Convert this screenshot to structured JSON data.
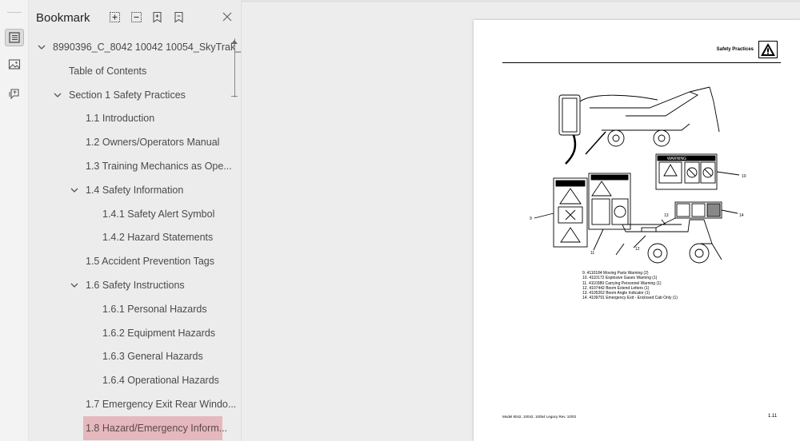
{
  "panel": {
    "title": "Bookmark"
  },
  "tree": [
    {
      "label": "8990396_C_8042 10042 10054_SkyTrak_...",
      "level": 0,
      "expanded": true
    },
    {
      "label": "Table of Contents",
      "level": 1,
      "expanded": null
    },
    {
      "label": "Section 1 Safety Practices",
      "level": 1,
      "expanded": true
    },
    {
      "label": "1.1 Introduction",
      "level": 2,
      "expanded": null
    },
    {
      "label": "1.2 Owners/Operators Manual",
      "level": 2,
      "expanded": null
    },
    {
      "label": "1.3 Training Mechanics as Ope...",
      "level": 2,
      "expanded": null
    },
    {
      "label": "1.4 Safety Information",
      "level": 2,
      "expanded": true
    },
    {
      "label": "1.4.1 Safety Alert Symbol",
      "level": 3,
      "expanded": null
    },
    {
      "label": "1.4.2 Hazard Statements",
      "level": 3,
      "expanded": null
    },
    {
      "label": "1.5 Accident Prevention Tags",
      "level": 2,
      "expanded": null
    },
    {
      "label": "1.6 Safety Instructions",
      "level": 2,
      "expanded": true
    },
    {
      "label": "1.6.1 Personal Hazards",
      "level": 3,
      "expanded": null
    },
    {
      "label": "1.6.2 Equipment Hazards",
      "level": 3,
      "expanded": null
    },
    {
      "label": "1.6.3 General Hazards",
      "level": 3,
      "expanded": null
    },
    {
      "label": "1.6.4 Operational Hazards",
      "level": 3,
      "expanded": null
    },
    {
      "label": "1.7 Emergency Exit Rear Windo...",
      "level": 2,
      "expanded": null
    },
    {
      "label": "1.8 Hazard/Emergency Inform...",
      "level": 2,
      "expanded": null,
      "selected": true
    }
  ],
  "doc": {
    "header": "Safety Practices",
    "callouts": {
      "n9": "9",
      "n10": "10",
      "n11": "11",
      "n12": "12",
      "n13": "13",
      "n14": "14"
    },
    "warning_label": "WARNING",
    "legend": [
      "9.  4110184 Moving Parts Warning (2)",
      "10. 4110172 Explosive Gases Warning (1)",
      "11. 4110389 Carrying Personnel Warning (1)",
      "12. 4107442 Boom Extend Letters (1)",
      "13. 4105262 Boom Angle Indicator (1)",
      "14. 4109791 Emergency Exit - Enclosed Cab Only (1)"
    ],
    "footer_left": "Model 8042, 10042, 10054 Legacy   Rev. 10/03",
    "page_number": "1.11"
  },
  "colors": {
    "selection": "#e5b8bd",
    "panel_bg": "#ececec"
  }
}
